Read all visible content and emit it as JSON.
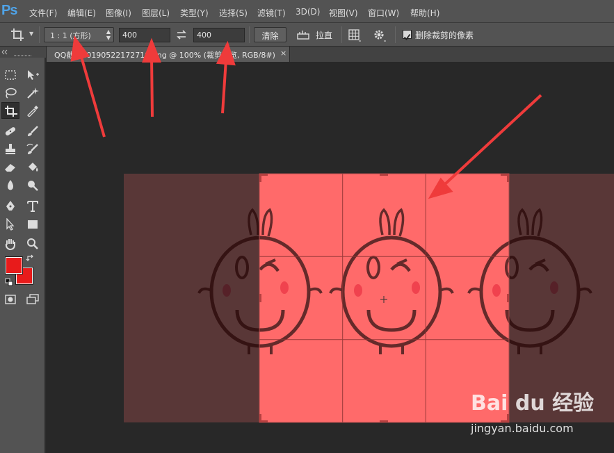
{
  "app": {
    "logo": "Ps",
    "menu": [
      "文件(F)",
      "编辑(E)",
      "图像(I)",
      "图层(L)",
      "类型(Y)",
      "选择(S)",
      "滤镜(T)",
      "3D(D)",
      "视图(V)",
      "窗口(W)",
      "帮助(H)"
    ]
  },
  "options": {
    "ratio": "1 : 1 (方形)",
    "width": "400",
    "height": "400",
    "clear_label": "清除",
    "straighten_label": "拉直",
    "delete_cropped_label": "删除裁剪的像素",
    "delete_cropped_checked": true
  },
  "document": {
    "tab_title": "QQ截图20190522172719.png @ 100% (裁剪预览, RGB/8#)",
    "close": "×"
  },
  "colors": {
    "foreground": "#e81b1b",
    "background": "#e81b1b",
    "crop_fill": "#ff5f5f",
    "arrow": "#ef3b3b"
  },
  "watermark": {
    "brand": "Bai du 经验",
    "url": "jingyan.baidu.com"
  }
}
